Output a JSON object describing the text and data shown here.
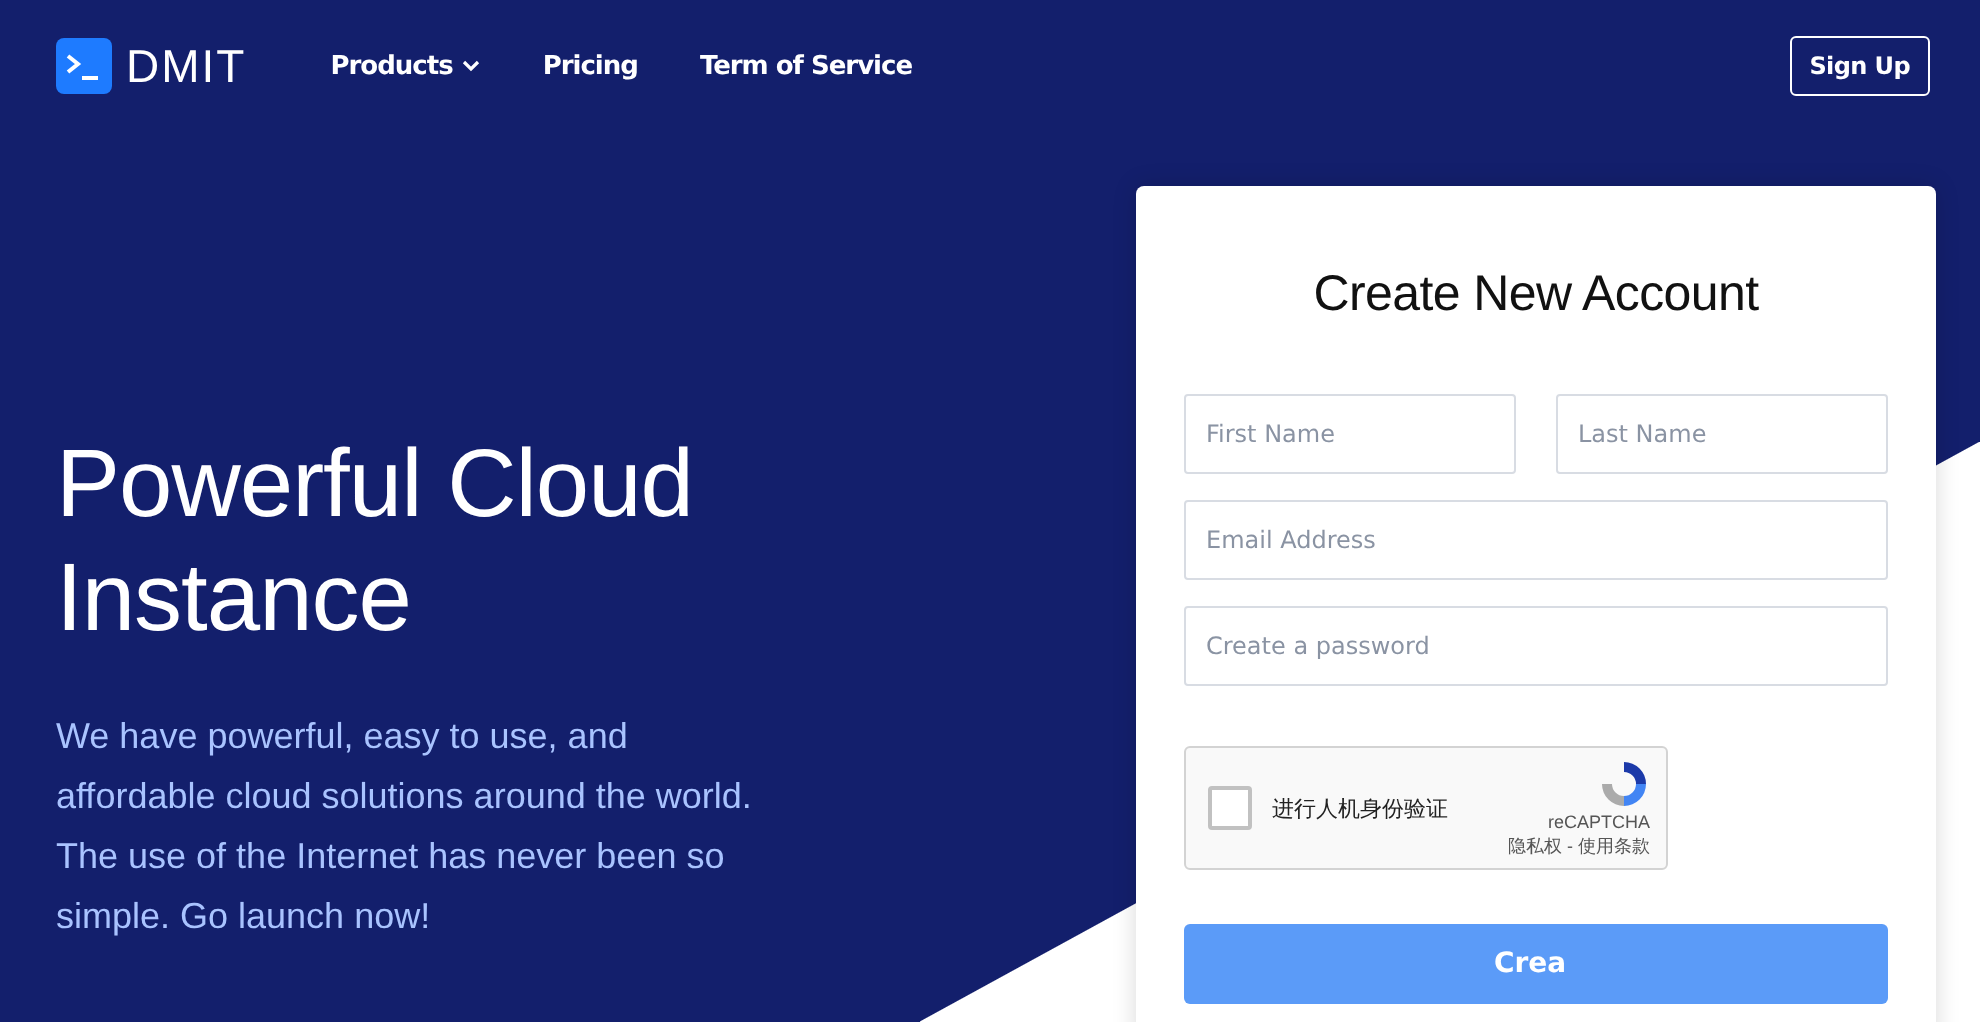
{
  "nav": {
    "logo_text": "DMIT",
    "links": [
      {
        "label": "Products",
        "dropdown": true
      },
      {
        "label": "Pricing",
        "dropdown": false
      },
      {
        "label": "Term of Service",
        "dropdown": false
      }
    ],
    "signup": "Sign Up"
  },
  "hero": {
    "title": "Powerful Cloud Instance",
    "text": "We have powerful, easy to use, and affordable cloud solutions around the world. The use of the Internet has never been so simple. Go launch now!"
  },
  "form": {
    "title": "Create New Account",
    "fields": [
      {
        "placeholder": "First Name"
      },
      {
        "placeholder": "Last Name"
      },
      {
        "placeholder": "Email Address"
      },
      {
        "placeholder": "Create a password"
      }
    ],
    "captcha": {
      "label": "进行人机身份验证",
      "checked": false,
      "brand": "reCAPTCHA",
      "links": "隐私权 - 使用条款"
    },
    "submit": "Crea"
  }
}
